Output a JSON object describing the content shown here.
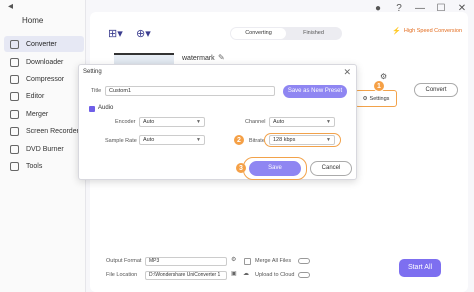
{
  "window": {
    "minimize": "—",
    "maximize": "☐",
    "close": "✕",
    "help_icon": "?",
    "user_icon": "●"
  },
  "sidebar": {
    "back": "◂",
    "home": "Home",
    "items": [
      {
        "label": "Converter",
        "active": true
      },
      {
        "label": "Downloader"
      },
      {
        "label": "Compressor"
      },
      {
        "label": "Editor"
      },
      {
        "label": "Merger"
      },
      {
        "label": "Screen Recorder"
      },
      {
        "label": "DVD Burner"
      },
      {
        "label": "Tools"
      }
    ]
  },
  "toolbar": {
    "add_file_icon": "⊞▾",
    "add_more_icon": "⊕▾",
    "tabs": [
      "Converting",
      "Finished"
    ],
    "high_speed": "High Speed Conversion"
  },
  "file": {
    "name": "watermark",
    "convert": "Convert",
    "settings": "Settings"
  },
  "dialog": {
    "title": "Setting",
    "title_label": "Title",
    "title_value": "Custom1",
    "save_preset": "Save as New Preset",
    "section": "Audio",
    "encoder_label": "Encoder",
    "encoder_value": "Auto",
    "channel_label": "Channel",
    "channel_value": "Auto",
    "sample_rate_label": "Sample Rate",
    "sample_rate_value": "Auto",
    "bitrate_label": "Bitrate",
    "bitrate_value": "128 kbps",
    "save": "Save",
    "cancel": "Cancel"
  },
  "callouts": [
    "1",
    "2",
    "3"
  ],
  "bottom": {
    "output_format_label": "Output Format",
    "output_format_value": "MP3",
    "merge_label": "Merge All Files",
    "location_label": "File Location",
    "location_value": "D:\\Wondershare UniConverter 1",
    "upload_label": "Upload to Cloud",
    "start_all": "Start All"
  },
  "colors": {
    "accent": "#8f86f2",
    "highlight": "#f2a24a",
    "brand_orange": "#e36b1d"
  }
}
